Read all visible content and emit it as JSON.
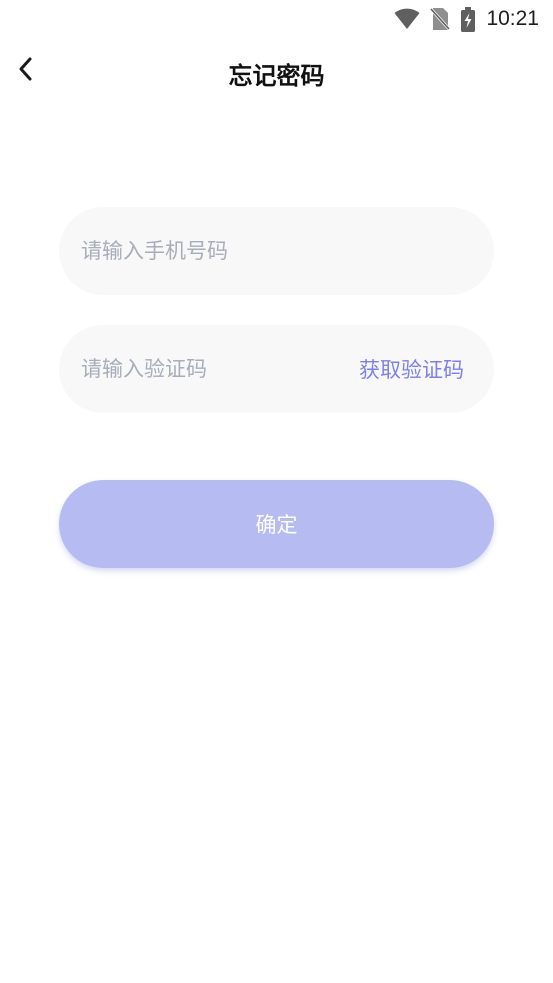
{
  "status_bar": {
    "time": "10:21",
    "icons": [
      "wifi-icon",
      "no-sim-icon",
      "battery-charging-icon"
    ]
  },
  "header": {
    "title": "忘记密码",
    "back_icon": "chevron-left-icon"
  },
  "form": {
    "phone_placeholder": "请输入手机号码",
    "phone_value": "",
    "code_placeholder": "请输入验证码",
    "code_value": "",
    "get_code_label": "获取验证码",
    "confirm_label": "确定"
  },
  "colors": {
    "accent": "#7e80eb",
    "button_bg": "#b6bcf2",
    "field_bg": "#f8f8f8",
    "placeholder": "#a7adb9"
  }
}
